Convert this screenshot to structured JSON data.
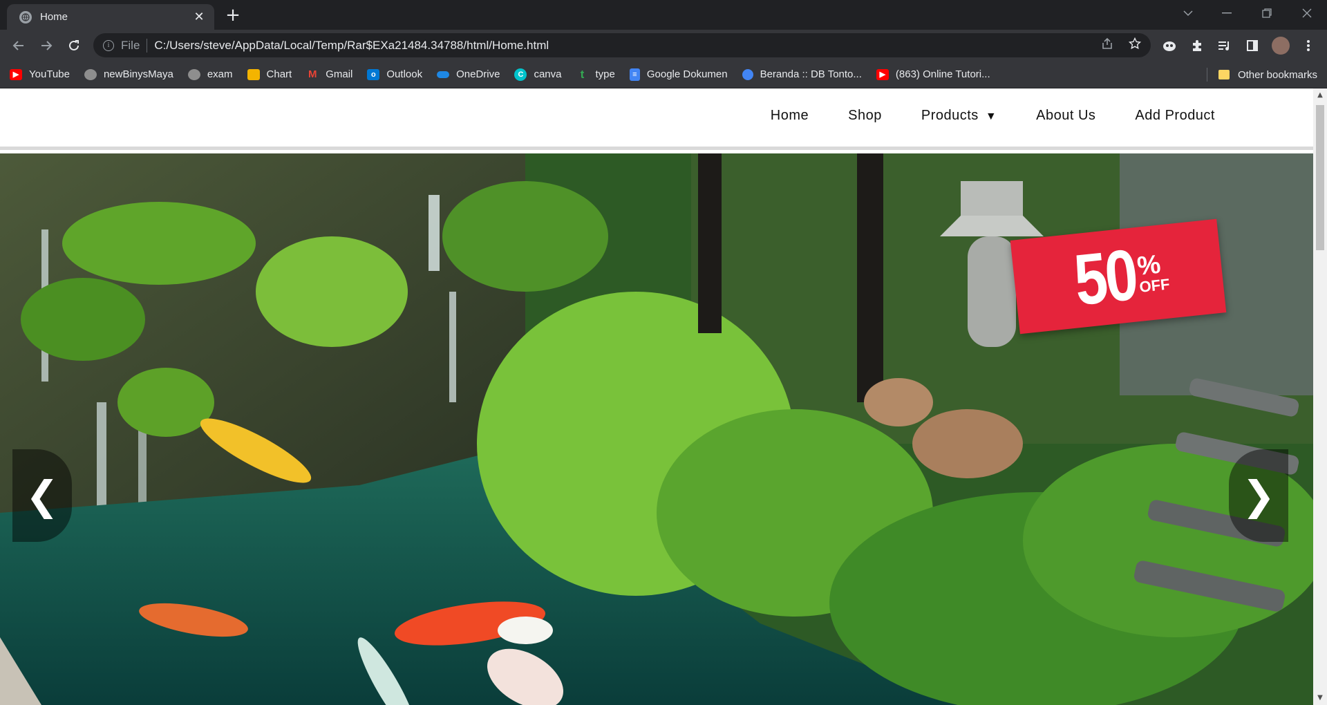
{
  "browser": {
    "tab": {
      "title": "Home",
      "close": "✕"
    },
    "new_tab": "+",
    "address": {
      "scheme": "File",
      "url": "C:/Users/steve/AppData/Local/Temp/Rar$EXa21484.34788/html/Home.html"
    },
    "bookmarks": [
      {
        "label": "YouTube",
        "icon": "youtube-icon",
        "color": "#ff0000"
      },
      {
        "label": "newBinysMaya",
        "icon": "maya-icon",
        "color": "#8e8e8e"
      },
      {
        "label": "exam",
        "icon": "maya-icon",
        "color": "#8e8e8e"
      },
      {
        "label": "Chart",
        "icon": "chart-icon",
        "color": "#f4b400"
      },
      {
        "label": "Gmail",
        "icon": "gmail-icon",
        "color": "#ea4335"
      },
      {
        "label": "Outlook",
        "icon": "outlook-icon",
        "color": "#0078d4"
      },
      {
        "label": "OneDrive",
        "icon": "onedrive-icon",
        "color": "#1e88e5"
      },
      {
        "label": "canva",
        "icon": "canva-icon",
        "color": "#00c4cc"
      },
      {
        "label": "type",
        "icon": "type-icon",
        "color": "#34a853"
      },
      {
        "label": "Google Dokumen",
        "icon": "docs-icon",
        "color": "#4285f4"
      },
      {
        "label": "Beranda :: DB Tonto...",
        "icon": "database-icon",
        "color": "#4285f4"
      },
      {
        "label": "(863) Online Tutori...",
        "icon": "youtube-icon",
        "color": "#ff0000"
      }
    ],
    "other_bookmarks": "Other bookmarks"
  },
  "site": {
    "nav": {
      "home": "Home",
      "shop": "Shop",
      "products": "Products",
      "products_caret": "▼",
      "about": "About Us",
      "add_product": "Add Product"
    },
    "hero": {
      "prev": "❮",
      "next": "❯",
      "promo_number": "50",
      "promo_percent": "%",
      "promo_off": "OFF"
    }
  },
  "colors": {
    "promo_red": "#e5243b",
    "pond_green": "#14503f"
  }
}
